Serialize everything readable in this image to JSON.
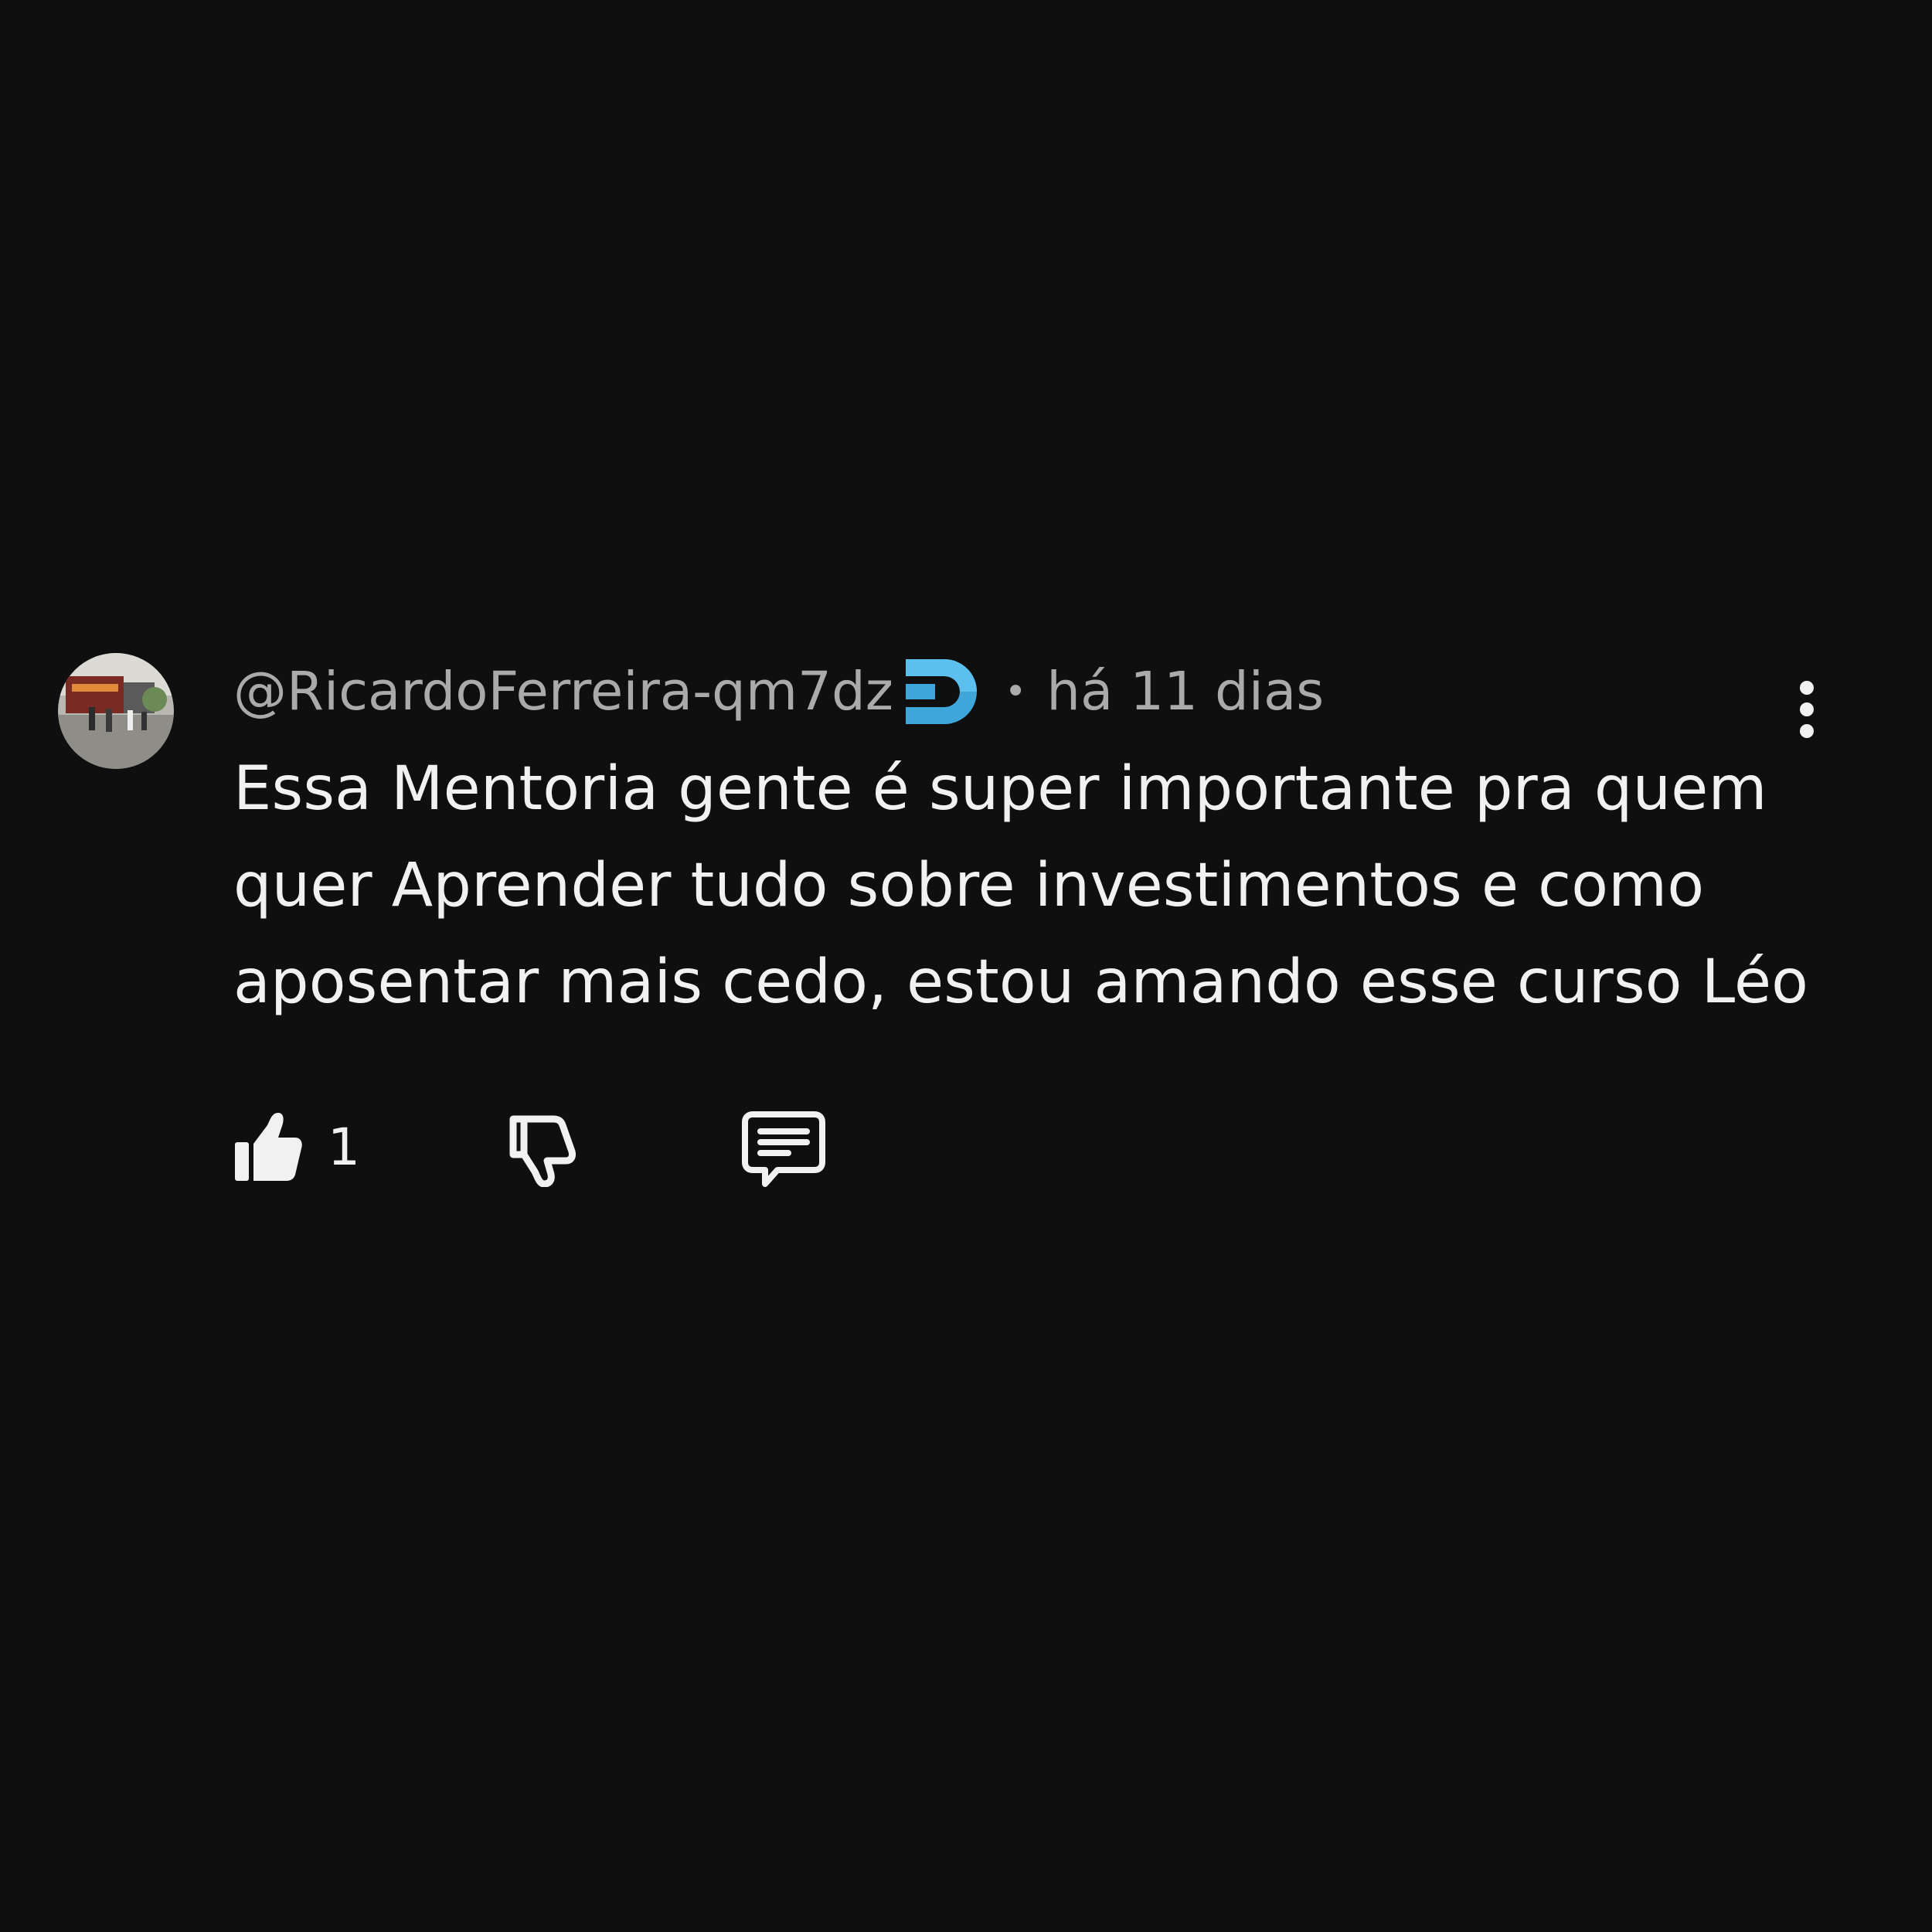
{
  "comment": {
    "author": "@RicardoFerreira-qm7dz",
    "separator": "•",
    "time": "há 11 dias",
    "text": "Essa Mentoria gente é super importante pra quem quer Aprender tudo sobre investimentos e como aposentar mais cedo, estou amando esse curso Léo",
    "like_count": "1",
    "badge_color": "#3ea6d8"
  },
  "icons": {
    "avatar": "avatar-photo",
    "badge": "membership-badge-icon",
    "like": "thumbs-up-icon",
    "dislike": "thumbs-down-icon",
    "reply": "reply-comment-icon",
    "menu": "more-vert-icon"
  },
  "colors": {
    "background": "#0f0f0f",
    "text": "#f1f1f1",
    "meta": "#aaaaaa"
  }
}
